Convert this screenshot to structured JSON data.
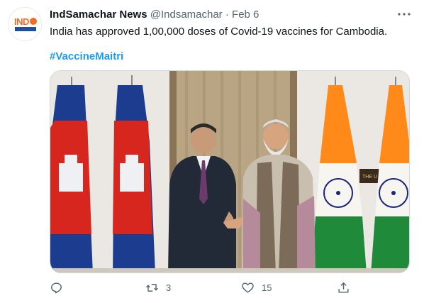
{
  "tweet": {
    "display_name": "IndSamachar News",
    "handle": "@Indsamachar",
    "separator": "·",
    "date": "Feb 6",
    "text": "India has approved 1,00,000 doses of Covid-19 vaccines for Cambodia.",
    "hashtag": "#VaccineMaitri",
    "avatar_label": "IND SAMACHAR",
    "photo_sign_text": "THE U"
  },
  "actions": {
    "reply_count": "",
    "retweet_count": "3",
    "like_count": "15"
  },
  "colors": {
    "accent": "#1d9bf0",
    "secondary_text": "#536471",
    "brand_orange": "#f26b21"
  },
  "icons": [
    "more-icon",
    "reply-icon",
    "retweet-icon",
    "like-icon",
    "share-icon"
  ]
}
